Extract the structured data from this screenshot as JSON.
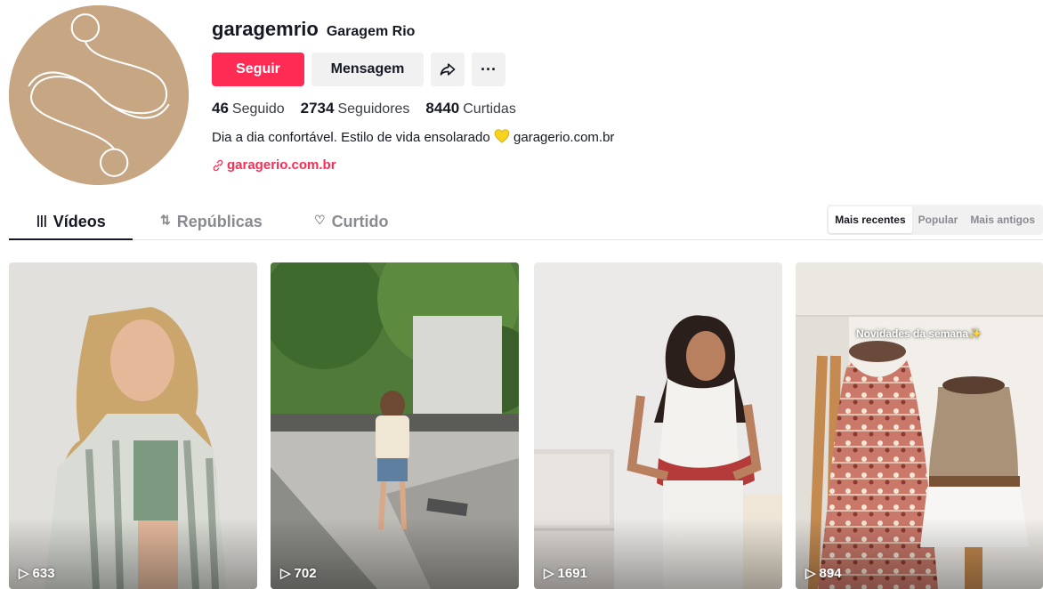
{
  "profile": {
    "username": "garagemrio",
    "display_name": "Garagem Rio",
    "follow_label": "Seguir",
    "message_label": "Mensagem",
    "share_icon": "share-arrow-icon",
    "more_label": "···",
    "stats": {
      "following_count": "46",
      "following_label": "Seguido",
      "followers_count": "2734",
      "followers_label": "Seguidores",
      "likes_count": "8440",
      "likes_label": "Curtidas"
    },
    "bio_text": "Dia a dia confortável. Estilo de vida ensolarado",
    "bio_link_text": "garagerio.com.br",
    "link_text": "garagerio.com.br",
    "avatar_color": "#c7a684"
  },
  "tabs": [
    {
      "label": "Vídeos",
      "icon": "|||",
      "active": true
    },
    {
      "label": "Repúblicas",
      "icon": "⇅",
      "active": false
    },
    {
      "label": "Curtido",
      "icon": "♡",
      "active": false
    }
  ],
  "sort": {
    "options": [
      "Mais recentes",
      "Popular",
      "Mais antigos"
    ],
    "selected": "Mais recentes"
  },
  "videos": [
    {
      "views": "633"
    },
    {
      "views": "702"
    },
    {
      "views": "1691"
    },
    {
      "views": "894",
      "overlay_text": "Novidades da semana✨"
    }
  ],
  "colors": {
    "accent": "#fe2c55",
    "text": "#161823",
    "button_bg": "#f1f1f2"
  }
}
